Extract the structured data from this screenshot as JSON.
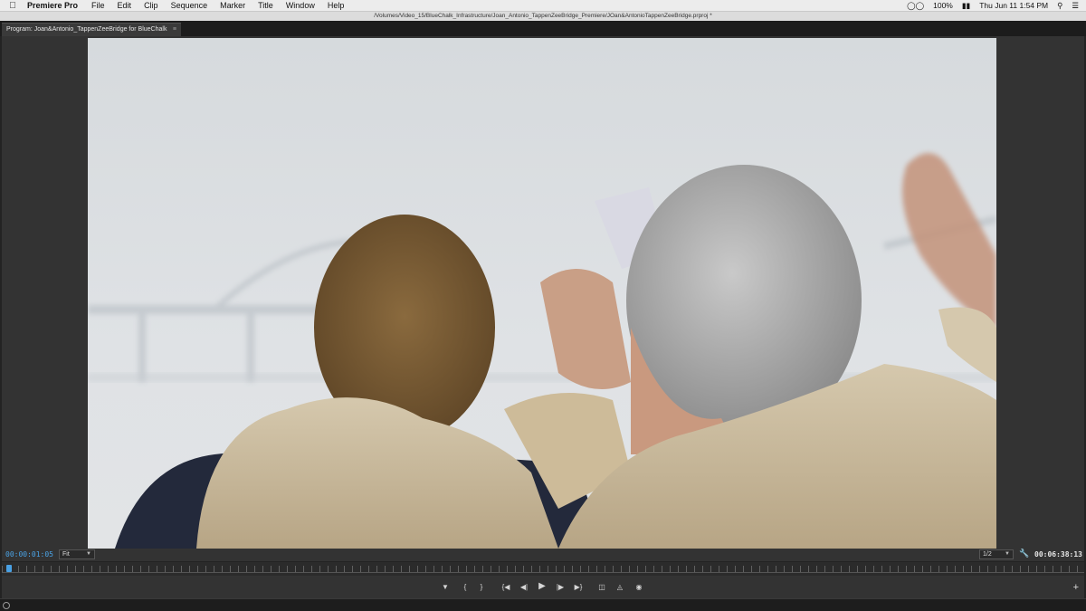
{
  "menubar": {
    "app_name": "Premiere Pro",
    "menus": [
      "File",
      "Edit",
      "Clip",
      "Sequence",
      "Marker",
      "Title",
      "Window",
      "Help"
    ],
    "battery": "100%",
    "datetime": "Thu Jun 11  1:54 PM"
  },
  "window": {
    "path": "/Volumes/Video_15/BlueChalk_Infrastructure/Joan_Antonio_TappenZeeBridge_Premiere/JOan&AntonioTappenZeeBridge.prproj *"
  },
  "panel": {
    "tab_label": "Program: Joan&Antonio_TappenZeeBridge for BlueChalk"
  },
  "monitor": {
    "current_timecode": "00:00:01:05",
    "zoom": "Fit",
    "resolution": "1/2",
    "duration_timecode": "00:06:38:13",
    "playhead_position_fraction": 0.003
  },
  "icons": {
    "marker": "marker-icon",
    "in_point": "in-point-icon",
    "out_point": "out-point-icon",
    "go_to_in": "go-to-in-icon",
    "step_back": "step-back-icon",
    "play": "play-icon",
    "step_forward": "step-forward-icon",
    "go_to_out": "go-to-out-icon",
    "lift": "lift-icon",
    "extract": "extract-icon",
    "export_frame": "camera-icon",
    "add_button": "plus-icon"
  },
  "colors": {
    "timecode_accent": "#4aa3e6",
    "panel_bg": "#333333"
  }
}
